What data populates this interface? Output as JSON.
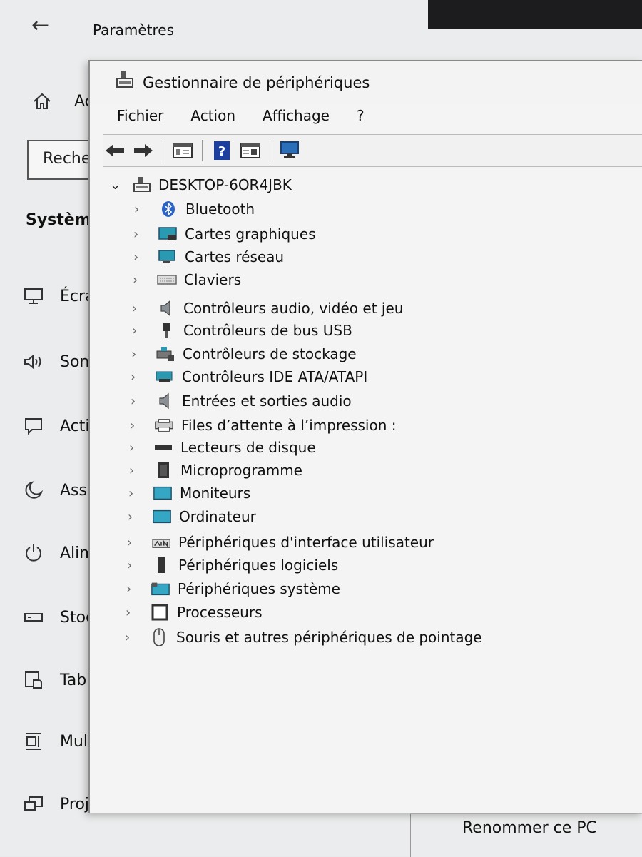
{
  "settings": {
    "title": "Paramètres",
    "home_label": "Acc",
    "search_text": "Recher",
    "section_title": "Système",
    "nav": [
      {
        "label": "Écra",
        "icon": "display-icon"
      },
      {
        "label": "Son",
        "icon": "speaker-icon"
      },
      {
        "label": "Acti",
        "icon": "notification-icon"
      },
      {
        "label": "Assi",
        "icon": "moon-icon"
      },
      {
        "label": "Alim",
        "icon": "power-icon"
      },
      {
        "label": "Stoc",
        "icon": "storage-icon"
      },
      {
        "label": "Tabl",
        "icon": "tablet-icon"
      },
      {
        "label": "Mul",
        "icon": "multitask-icon"
      },
      {
        "label": "Proj",
        "icon": "projector-icon"
      }
    ],
    "rename_button": "Renommer ce PC"
  },
  "device_manager": {
    "title": "Gestionnaire de périphériques",
    "menu": [
      "Fichier",
      "Action",
      "Affichage",
      "?"
    ],
    "root": "DESKTOP-6OR4JBK",
    "categories": [
      {
        "label": "Bluetooth",
        "icon": "bluetooth-icon"
      },
      {
        "label": "Cartes graphiques",
        "icon": "display-adapter-icon"
      },
      {
        "label": "Cartes réseau",
        "icon": "network-adapter-icon"
      },
      {
        "label": "Claviers",
        "icon": "keyboard-icon"
      },
      {
        "label": "Contrôleurs audio, vidéo et jeu",
        "icon": "audio-controller-icon"
      },
      {
        "label": "Contrôleurs de bus USB",
        "icon": "usb-icon"
      },
      {
        "label": "Contrôleurs de stockage",
        "icon": "storage-controller-icon"
      },
      {
        "label": "Contrôleurs IDE ATA/ATAPI",
        "icon": "ide-controller-icon"
      },
      {
        "label": "Entrées et sorties audio",
        "icon": "audio-io-icon"
      },
      {
        "label": "Files d’attente à l’impression :",
        "icon": "print-queue-icon"
      },
      {
        "label": "Lecteurs de disque",
        "icon": "disk-drive-icon"
      },
      {
        "label": "Microprogramme",
        "icon": "firmware-icon"
      },
      {
        "label": "Moniteurs",
        "icon": "monitor-icon"
      },
      {
        "label": "Ordinateur",
        "icon": "computer-icon"
      },
      {
        "label": "Périphériques d'interface utilisateur",
        "icon": "hid-icon"
      },
      {
        "label": "Périphériques logiciels",
        "icon": "software-device-icon"
      },
      {
        "label": "Périphériques système",
        "icon": "system-device-icon"
      },
      {
        "label": "Processeurs",
        "icon": "processor-icon"
      },
      {
        "label": "Souris et autres périphériques de pointage",
        "icon": "mouse-icon"
      }
    ]
  }
}
